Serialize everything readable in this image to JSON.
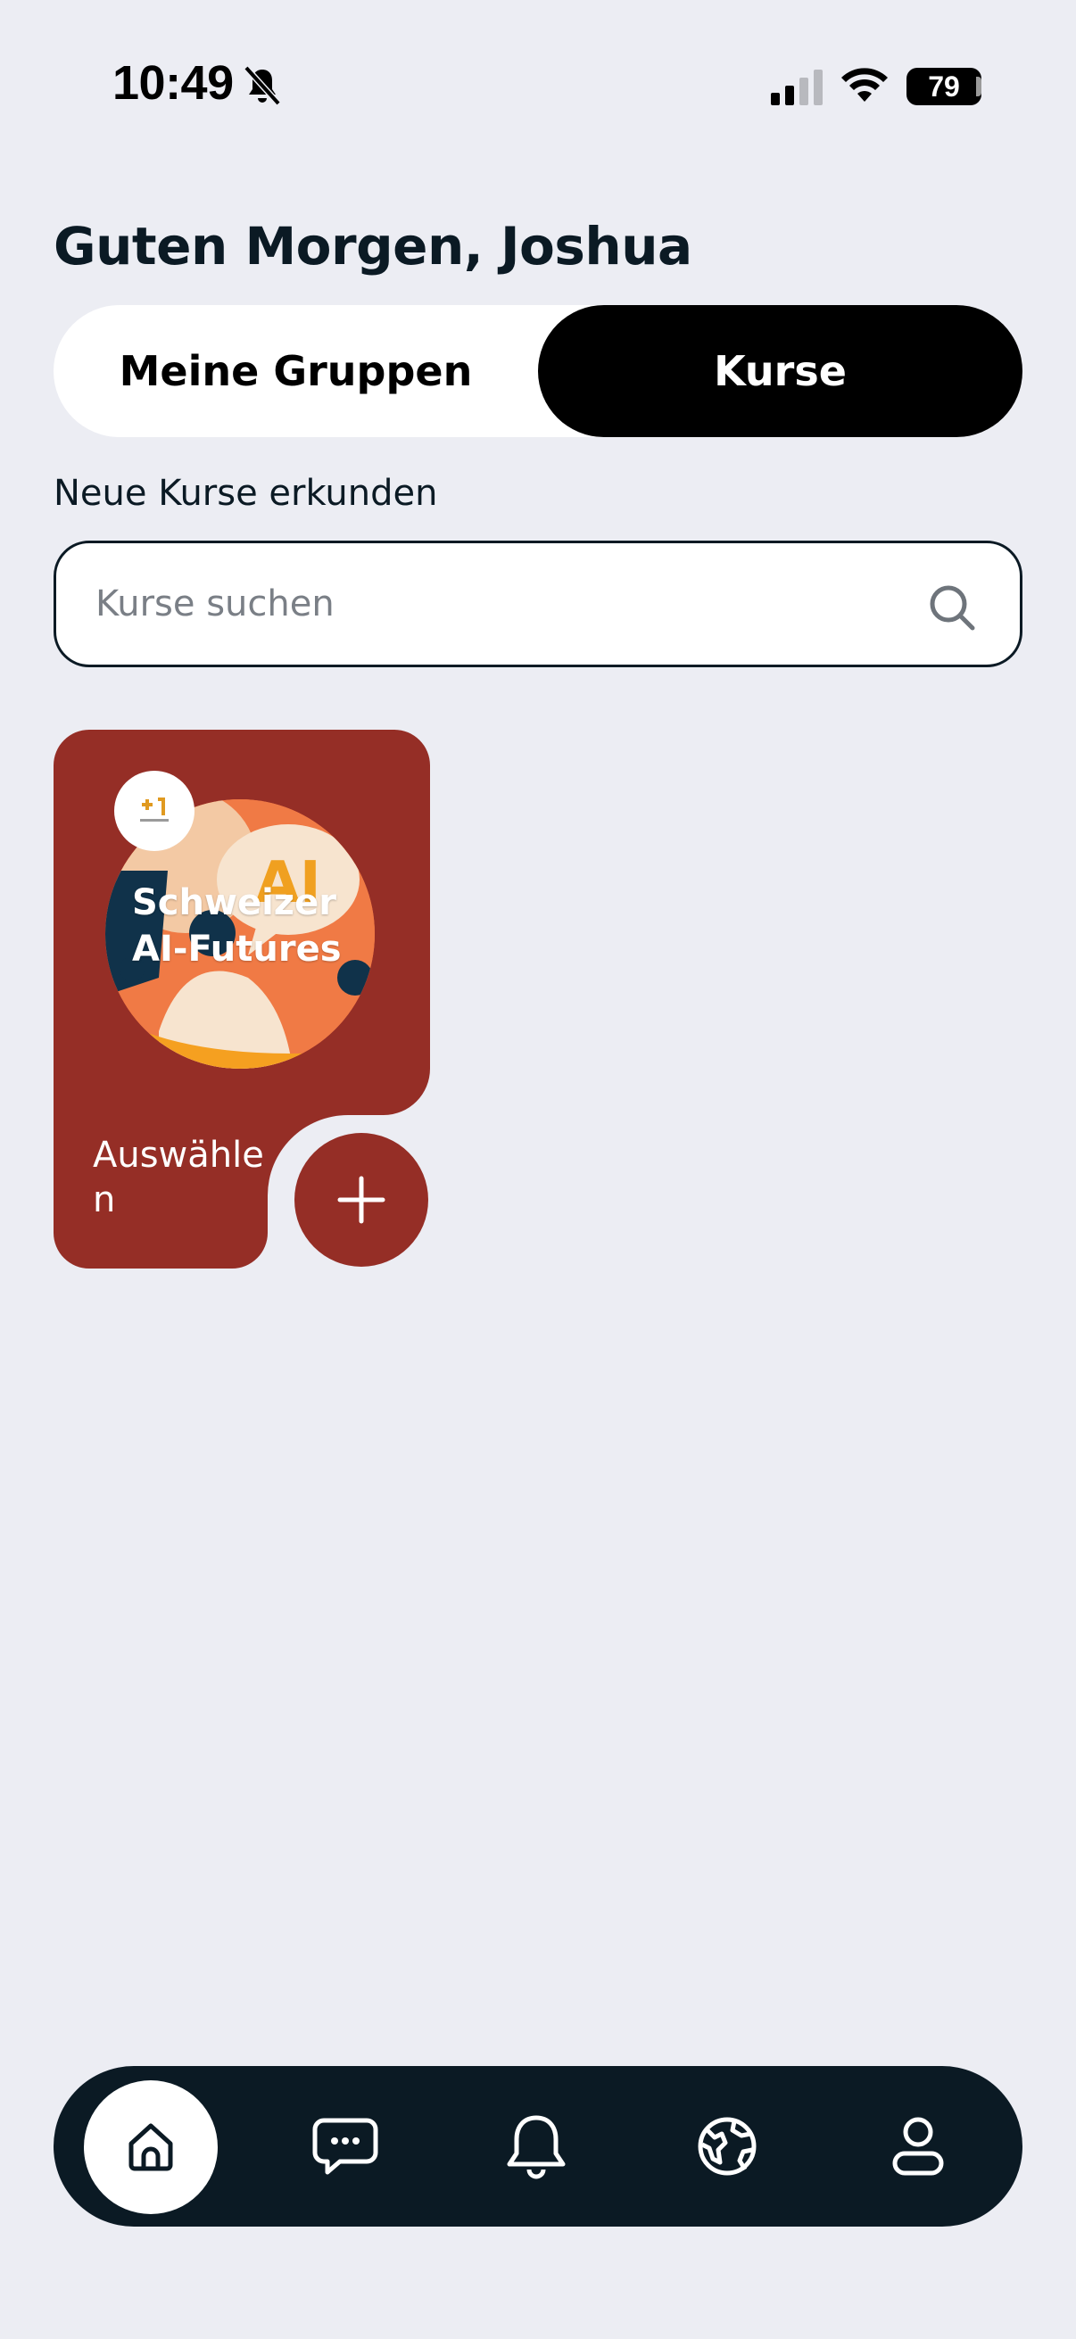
{
  "status_bar": {
    "time": "10:49",
    "battery": "79"
  },
  "header": {
    "greeting": "Guten Morgen, Joshua"
  },
  "tabs": [
    {
      "label": "Meine Gruppen",
      "selected": false
    },
    {
      "label": "Kurse",
      "selected": true
    }
  ],
  "explore": {
    "label": "Neue Kurse erkunden",
    "search_placeholder": "Kurse suchen",
    "search_value": ""
  },
  "courses": [
    {
      "title": "Schweizer AI-Futures",
      "image_text": "AI",
      "action_label": "Auswählen",
      "color": "#952E26"
    }
  ],
  "bottom_nav": {
    "items": [
      {
        "icon": "home-icon",
        "active": true
      },
      {
        "icon": "chat-icon",
        "active": false
      },
      {
        "icon": "bell-icon",
        "active": false
      },
      {
        "icon": "globe-icon",
        "active": false
      },
      {
        "icon": "profile-icon",
        "active": false
      }
    ]
  },
  "colors": {
    "background": "#ECEDF3",
    "dark": "#0B1A24",
    "course_card": "#952E26",
    "accent_orange": "#F07A45"
  }
}
